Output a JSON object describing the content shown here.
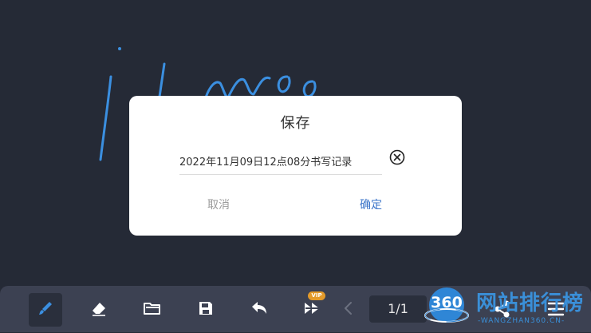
{
  "dialog": {
    "title": "保存",
    "filename_value": "2022年11月09日12点08分书写记录",
    "cancel_label": "取消",
    "confirm_label": "确定"
  },
  "toolbar": {
    "vip_badge": "VIP",
    "page_indicator": "1/1",
    "tools": [
      {
        "name": "pen-icon"
      },
      {
        "name": "eraser-icon"
      },
      {
        "name": "folder-icon"
      },
      {
        "name": "save-icon"
      },
      {
        "name": "undo-icon"
      },
      {
        "name": "fast-forward-icon"
      },
      {
        "name": "previous-page-icon"
      },
      {
        "name": "share-icon"
      },
      {
        "name": "menu-icon"
      }
    ]
  },
  "watermark": {
    "logo_text": "360",
    "title": "网站排行榜",
    "subtitle": "-WANGZHAN360.CN-"
  },
  "colors": {
    "canvas_background": "#252a36",
    "ink": "#3b8fe0",
    "toolbar_background": "#3c4152",
    "accent": "#3a74c9"
  }
}
